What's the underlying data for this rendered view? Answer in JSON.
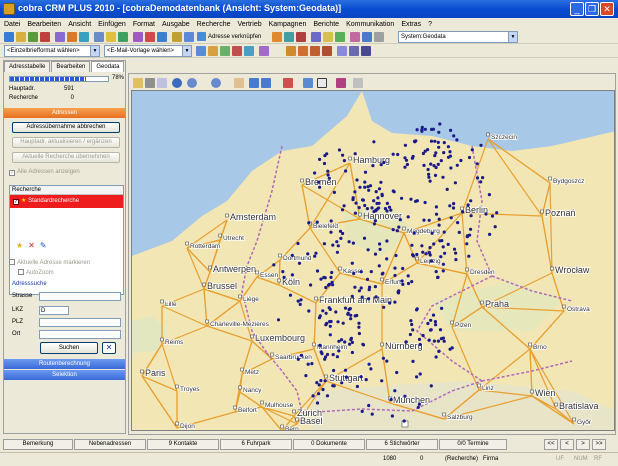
{
  "window": {
    "title": "cobra CRM PLUS 2010 - [cobraDemodatenbank (Ansicht: System:Geodata)]"
  },
  "menu": [
    "Datei",
    "Bearbeiten",
    "Ansicht",
    "Einfügen",
    "Format",
    "Ausgabe",
    "Recherche",
    "Vertrieb",
    "Kampagnen",
    "Berichte",
    "Kommunikation",
    "Extras",
    "?"
  ],
  "toolbar": {
    "adressen_verknuepfen": "Adresse verknüpfen",
    "view_select": "System:Geodata",
    "format_select": "<Einzelbriefformat wählen>",
    "email_select": "<E-Mail-Vorlage wählen>"
  },
  "leftpanel": {
    "tabs": [
      "Adresstabelle",
      "Bearbeiten",
      "Geodata"
    ],
    "progress_percent": 0.78,
    "progress_label": "78%",
    "hauptadr_label": "Hauptadr.",
    "hauptadr_value": "591",
    "recherche_label": "Recherche",
    "recherche_value": "0",
    "section_adressen": "Adressen",
    "btn_abbrechen": "Adressübernahme abbrechen",
    "btn_hauptadr": "Hauptadr. aktualisieren / ergänzen",
    "btn_recherche": "Aktuelle Recherche übernehmen",
    "chk_alle": "Alle Adressen anzeigen",
    "list_header": "Recherche",
    "list_selected": "Standardrecherche",
    "chk_markieren": "Aktuelle Adresse markieren",
    "chk_autozoom": "AutoZoom",
    "adresssuche_label": "Adresssuche",
    "strasse_label": "Strasse",
    "lkz_label": "LKZ",
    "lkz_value": "D",
    "plz_label": "PLZ",
    "ort_label": "Ort",
    "suchen": "Suchen",
    "section_routen": "Routenberechnung",
    "section_selektion": "Selektion"
  },
  "map": {
    "cities": [
      {
        "name": "Bremen"
      },
      {
        "name": "Hamburg"
      },
      {
        "name": "Szczecin"
      },
      {
        "name": "Bydgoszcz"
      },
      {
        "name": "Amsterdam"
      },
      {
        "name": "Hannover"
      },
      {
        "name": "Berlin"
      },
      {
        "name": "Utrecht"
      },
      {
        "name": "Bielefeld"
      },
      {
        "name": "Magdeburg"
      },
      {
        "name": "Poznań"
      },
      {
        "name": "Rotterdam"
      },
      {
        "name": "Dortmund"
      },
      {
        "name": "Kassel"
      },
      {
        "name": "Leipzig"
      },
      {
        "name": "Antwerpen"
      },
      {
        "name": "Essen"
      },
      {
        "name": "Dresden"
      },
      {
        "name": "Wrocław"
      },
      {
        "name": "Brussel"
      },
      {
        "name": "Köln"
      },
      {
        "name": "Erfurt"
      },
      {
        "name": "Liège"
      },
      {
        "name": "Lille"
      },
      {
        "name": "Frankfurt am Main"
      },
      {
        "name": "Praha"
      },
      {
        "name": "Luxembourg"
      },
      {
        "name": "Plzen"
      },
      {
        "name": "Ostrava"
      },
      {
        "name": "Charleville-Mézières"
      },
      {
        "name": "Mannheim"
      },
      {
        "name": "Nürnberg"
      },
      {
        "name": "Reims"
      },
      {
        "name": "Saarbrücken"
      },
      {
        "name": "Brno"
      },
      {
        "name": "Paris"
      },
      {
        "name": "Metz"
      },
      {
        "name": "Stuttgart"
      },
      {
        "name": "Nancy"
      },
      {
        "name": "Troyes"
      },
      {
        "name": "München"
      },
      {
        "name": "Linz"
      },
      {
        "name": "Wien"
      },
      {
        "name": "Bratislava"
      },
      {
        "name": "Győr"
      },
      {
        "name": "Mulhouse"
      },
      {
        "name": "Zürich"
      },
      {
        "name": "Salzburg"
      },
      {
        "name": "Belfort"
      },
      {
        "name": "Basel"
      },
      {
        "name": "Bern"
      },
      {
        "name": "Dijon"
      }
    ]
  },
  "bottomtabs": [
    "Bemerkung",
    "Nebenadressen",
    "9 Kontakte",
    "6 Fuhrpark",
    "0 Dokumente",
    "6 Stichwörter",
    "0/0 Termine"
  ],
  "nav": [
    "<<",
    "<",
    ">",
    ">>"
  ],
  "status": {
    "count": "1080",
    "zero": "0",
    "recherche": "(Recherche)",
    "firma": "Firma",
    "ind1": "UF",
    "ind2": "NUM",
    "ind3": "RF"
  }
}
